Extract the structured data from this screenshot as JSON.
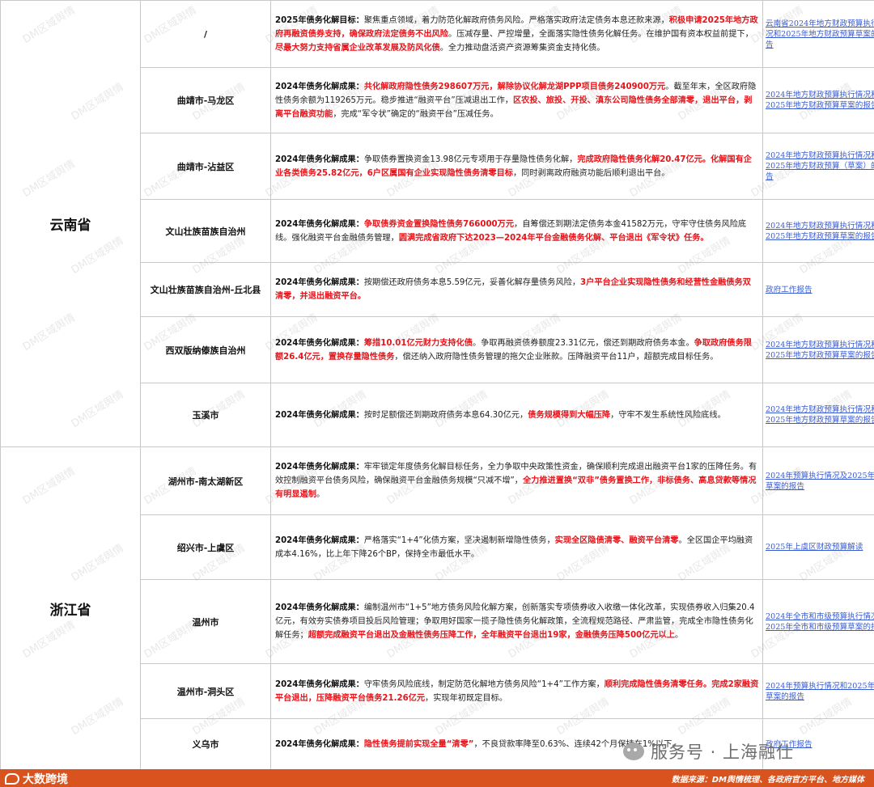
{
  "provinces": {
    "yunnan": "云南省",
    "zhejiang": "浙江省"
  },
  "rows": [
    {
      "region": "/",
      "height": 83,
      "content": [
        {
          "t": "2025年债务化解目标：",
          "s": "lbl"
        },
        {
          "t": "聚焦重点领域，着力防范化解政府债务风险。严格落实政府法定债务本息还款来源，",
          "s": ""
        },
        {
          "t": "积极申请2025年地方政府再融资债券支持，确保政府法定债务不出风险",
          "s": "hl"
        },
        {
          "t": "。压减存量、严控增量，全面落实隐性债务化解任务。在维护国有资本权益前提下，",
          "s": ""
        },
        {
          "t": "尽最大努力支持省属企业改革发展及防风化债",
          "s": "hl"
        },
        {
          "t": "。全力推动盘活资产资源筹集资金支持化债。",
          "s": ""
        }
      ],
      "source": "云南省2024年地方财政预算执行情况和2025年地方财政预算草案的报告"
    },
    {
      "region": "曲靖市-马龙区",
      "height": 81,
      "content": [
        {
          "t": "2024年债务化解成果：",
          "s": "lbl"
        },
        {
          "t": "共化解政府隐性债务298607万元，解除协议化解龙湖PPP项目债务240900万元",
          "s": "hl"
        },
        {
          "t": "。截至年末，全区政府隐性债务余额为119265万元。稳步推进“融资平台”压减退出工作，",
          "s": ""
        },
        {
          "t": "区农投、旅投、开投、滇东公司隐性债务全部清零，退出平台，剥离平台融资功能",
          "s": "hl"
        },
        {
          "t": "，完成“军令状”确定的“融资平台”压减任务。",
          "s": ""
        }
      ],
      "source": "2024年地方财政预算执行情况和2025年地方财政预算草案的报告"
    },
    {
      "region": "曲靖市-沾益区",
      "height": 82,
      "content": [
        {
          "t": "2024年债务化解成果：",
          "s": "lbl"
        },
        {
          "t": "争取债券置换资金13.98亿元专项用于存量隐性债务化解，",
          "s": ""
        },
        {
          "t": "完成政府隐性债务化解20.47亿元。化解国有企业各类债务25.82亿元，6户区属国有企业实现隐性债务清零目标",
          "s": "hl"
        },
        {
          "t": "，同时剥离政府融资功能后顺利退出平台。",
          "s": ""
        }
      ],
      "source": "2024年地方财政预算执行情况和2025年地方财政预算（草案）的报告"
    },
    {
      "region": "文山壮族苗族自治州",
      "height": 78,
      "content": [
        {
          "t": "2024年债务化解成果：",
          "s": "lbl"
        },
        {
          "t": "争取债券资金置换隐性债务766000万元",
          "s": "hl"
        },
        {
          "t": "，自筹偿还到期法定债务本金41582万元，守牢守住债务风险底线。强化融资平台金融债务管理，",
          "s": ""
        },
        {
          "t": "圆满完成省政府下达2023—2024年平台金融债务化解、平台退出《军令状》任务。",
          "s": "hl"
        }
      ],
      "source": "2024年地方财政预算执行情况和2025年地方财政预算草案的报告"
    },
    {
      "region": "文山壮族苗族自治州-丘北县",
      "height": 67,
      "content": [
        {
          "t": "2024年债务化解成果：",
          "s": "lbl"
        },
        {
          "t": "按期偿还政府债务本息5.59亿元，妥善化解存量债务风险，",
          "s": ""
        },
        {
          "t": "3户平台企业实现隐性债务和经营性金融债务双清零，并退出融资平台。",
          "s": "hl"
        }
      ],
      "source": "政府工作报告"
    },
    {
      "region": "西双版纳傣族自治州",
      "height": 82,
      "content": [
        {
          "t": "2024年债务化解成果：",
          "s": "lbl"
        },
        {
          "t": "筹措10.01亿元财力支持化债",
          "s": "hl"
        },
        {
          "t": "。争取再融资债券额度23.31亿元，偿还到期政府债务本金。",
          "s": ""
        },
        {
          "t": "争取政府债务限额26.4亿元，置换存量隐性债务",
          "s": "hl"
        },
        {
          "t": "，偿还纳入政府隐性债务管理的拖欠企业账款。压降融资平台11户，超额完成目标任务。",
          "s": ""
        }
      ],
      "source": "2024年地方财政预算执行情况和2025年地方财政预算草案的报告"
    },
    {
      "region": "玉溪市",
      "height": 79,
      "content": [
        {
          "t": "2024年债务化解成果：",
          "s": "lbl"
        },
        {
          "t": "按时足额偿还到期政府债务本息64.30亿元，",
          "s": ""
        },
        {
          "t": "债务规模得到大幅压降",
          "s": "hl"
        },
        {
          "t": "，守牢不发生系统性风险底线。",
          "s": ""
        }
      ],
      "source": "2024年地方财政预算执行情况和2025年地方财政预算草案的报告"
    },
    {
      "region": "湖州市-南太湖新区",
      "height": 84,
      "content": [
        {
          "t": "2024年债务化解成果：",
          "s": "lbl"
        },
        {
          "t": "牢牢锁定年度债务化解目标任务，全力争取中央政策性资金，确保顺利完成退出融资平台1家的压降任务。有效控制融资平台债务风险，确保融资平台金融债务规模“只减不增”，",
          "s": ""
        },
        {
          "t": "全力推进置换“双非”债务置换工作，非标债务、高息贷款等情况有明显遏制",
          "s": "hl"
        },
        {
          "t": "。",
          "s": ""
        }
      ],
      "source": "2024年预算执行情况及2025年预算草案的报告"
    },
    {
      "region": "绍兴市-上虞区",
      "height": 80,
      "content": [
        {
          "t": "2024年债务化解成果：",
          "s": "lbl"
        },
        {
          "t": "严格落实“1+4”化债方案，坚决遏制新增隐性债务，",
          "s": ""
        },
        {
          "t": "实现全区隐债清零、融资平台清零",
          "s": "hl"
        },
        {
          "t": "。全区国企平均融资成本4.16%，比上年下降26个BP，保持全市最低水平。",
          "s": ""
        }
      ],
      "source": "2025年上虞区财政预算解读"
    },
    {
      "region": "温州市",
      "height": 104,
      "content": [
        {
          "t": "2024年债务化解成果：",
          "s": "lbl"
        },
        {
          "t": "编制温州市“1+5”地方债务风险化解方案，创新落实专项债券收入收缴一体化改革，实现债券收入归集20.4亿元，有效夯实债券项目投后风险管理；争取用好国家一揽子隐性债务化解政策，全流程规范路径、严肃监管，完成全市隐性债务化解任务；",
          "s": ""
        },
        {
          "t": "超额完成融资平台退出及金融性债务压降工作，全年融资平台退出19家，金融债务压降500亿元以上",
          "s": "hl"
        },
        {
          "t": "。",
          "s": ""
        }
      ],
      "source": "2024年全市和市级预算执行情况及 2025年全市和市级预算草案的报告"
    },
    {
      "region": "温州市-洞头区",
      "height": 68,
      "content": [
        {
          "t": "2024年债务化解成果：",
          "s": "lbl"
        },
        {
          "t": "守牢债务风险底线，制定防范化解地方债务风险“1+4”工作方案，",
          "s": ""
        },
        {
          "t": "顺利完成隐性债务清零任务。完成2家融资平台退出，压降融资平台债务21.26亿元",
          "s": "hl"
        },
        {
          "t": "，实现年初既定目标。",
          "s": ""
        }
      ],
      "source": "2024年预算执行情况和2025年预算草案的报告"
    },
    {
      "region": "义乌市",
      "height": 63,
      "content": [
        {
          "t": "2024年债务化解成果：",
          "s": "lbl"
        },
        {
          "t": "隐性债务提前实现全量“清零”",
          "s": "hl"
        },
        {
          "t": "，不良贷款率降至0.63%、连续42个月保持在1%以下。",
          "s": ""
        }
      ],
      "source": "政府工作报告"
    }
  ],
  "watermark": "DM区域舆情",
  "footer": {
    "logo_text": "大数跨境",
    "source": "数据来源：DM舆情梳理、各政府官方平台、地方媒体"
  },
  "official_account": "服务号 · 上海融仕"
}
